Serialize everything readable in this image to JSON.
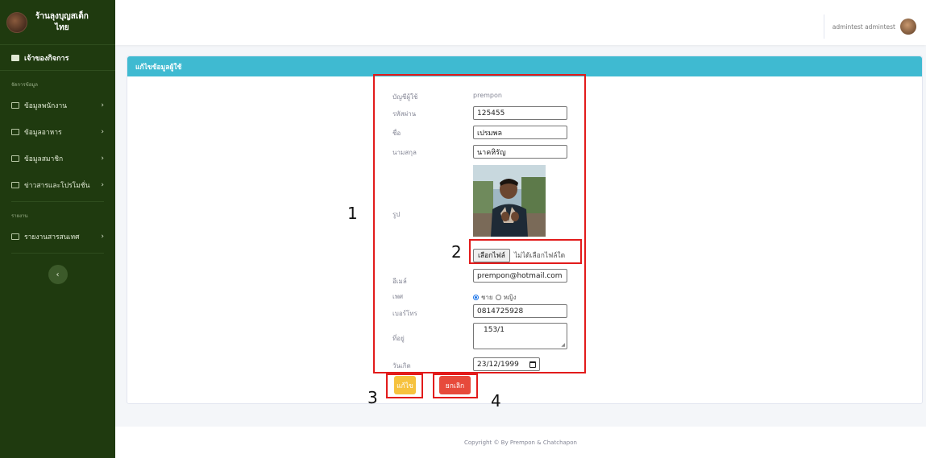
{
  "brand": {
    "title_line1": "ร้านลุงบุญสเต็ก",
    "title_line2": "ไทย"
  },
  "sidebar": {
    "top_item": "เจ้าของกิจการ",
    "heading_data": "จัดการข้อมูล",
    "items": [
      {
        "label": "ข้อมูลพนักงาน"
      },
      {
        "label": "ข้อมูลอาหาร"
      },
      {
        "label": "ข้อมูลสมาชิก"
      },
      {
        "label": "ข่าวสารและโปรโมชั่น"
      }
    ],
    "heading_report": "รายงาน",
    "report_items": [
      {
        "label": "รายงานสารสนเทศ"
      }
    ],
    "chevron": "›",
    "collapse": "‹"
  },
  "topbar": {
    "username": "admintest admintest"
  },
  "card": {
    "title": "แก้ไขข้อมูลผู้ใช้"
  },
  "form": {
    "labels": {
      "username": "บัญชีผู้ใช้",
      "password": "รหัสผ่าน",
      "firstname": "ชื่อ",
      "lastname": "นามสกุล",
      "photo": "รูป",
      "email": "อีเมล์",
      "gender": "เพศ",
      "phone": "เบอร์โทร",
      "address": "ที่อยู่",
      "birthday": "วันเกิด"
    },
    "username": "prempon",
    "password": "125455",
    "firstname": "เปรมพล",
    "lastname": "นาคหิรัญ",
    "file_button": "เลือกไฟล์",
    "file_status": "ไม่ได้เลือกไฟล์ใด",
    "email": "prempon@hotmail.com",
    "gender_options": [
      "ชาย",
      "หญิง"
    ],
    "gender_selected": "ชาย",
    "phone": "0814725928",
    "address": "153/1",
    "birthday": "23/12/1999"
  },
  "buttons": {
    "edit": "แก้ไข",
    "cancel": "ยกเลิก"
  },
  "annotations": [
    "1",
    "2",
    "3",
    "4"
  ],
  "footer": "Copyright © By Prempon & Chatchapon",
  "colors": {
    "sidebar": "#1f3a0f",
    "header": "#3fbad1",
    "edit": "#f6c23e",
    "cancel": "#e74a3b",
    "annotation": "#e21b1b"
  }
}
